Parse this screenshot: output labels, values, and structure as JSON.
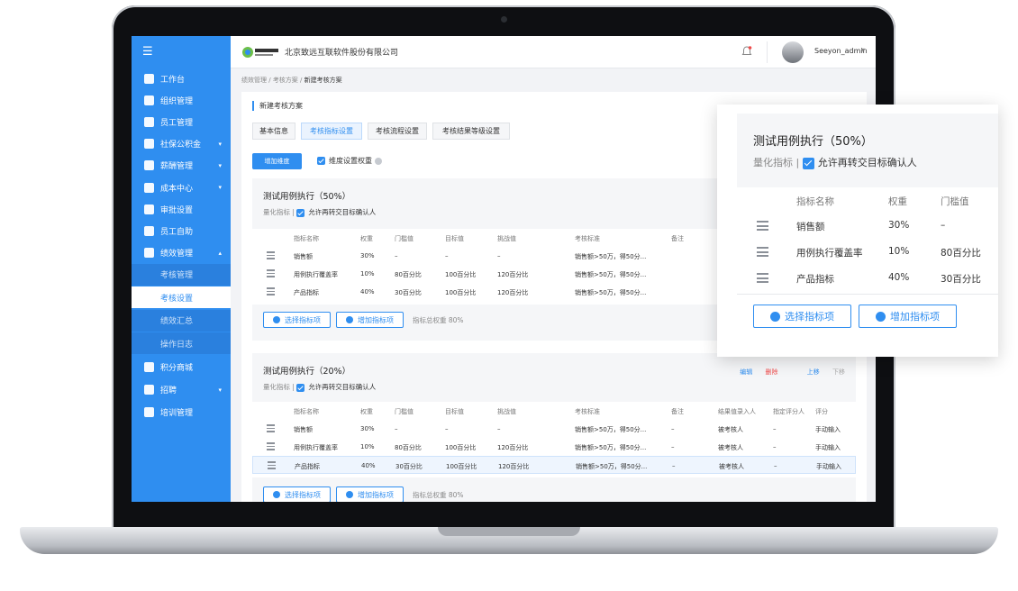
{
  "app": {
    "menu_toggle": "☰",
    "company": "北京致远互联软件股份有限公司",
    "logo_text": "致远互联",
    "username": "Seeyon_admin"
  },
  "sidebar": {
    "items": [
      {
        "label": "工作台",
        "icon": "desktop-icon"
      },
      {
        "label": "组织管理",
        "icon": "org-icon"
      },
      {
        "label": "员工管理",
        "icon": "user-icon"
      },
      {
        "label": "社保公积金",
        "icon": "shield-icon",
        "arrow": "▾"
      },
      {
        "label": "薪酬管理",
        "icon": "money-bag-icon",
        "arrow": "▾"
      },
      {
        "label": "成本中心",
        "icon": "grid-icon",
        "arrow": "▾"
      },
      {
        "label": "审批设置",
        "icon": "stamp-icon"
      },
      {
        "label": "员工自助",
        "icon": "person-icon"
      },
      {
        "label": "绩效管理",
        "icon": "chart-icon",
        "arrow": "▴"
      }
    ],
    "sub_items": [
      {
        "label": "考核管理"
      },
      {
        "label": "考核设置",
        "active": true
      },
      {
        "label": "绩效汇总"
      },
      {
        "label": "操作日志"
      }
    ],
    "items_after": [
      {
        "label": "积分商城",
        "icon": "gift-icon"
      },
      {
        "label": "招聘",
        "icon": "briefcase-icon",
        "arrow": "▾"
      },
      {
        "label": "培训管理",
        "icon": "graduation-icon"
      }
    ]
  },
  "breadcrumb": {
    "a": "绩效管理",
    "b": "考核方案",
    "c": "新建考核方案",
    "sep": " / "
  },
  "page": {
    "title": "新建考核方案",
    "tabs": [
      "基本信息",
      "考核指标设置",
      "考核流程设置",
      "考核结果等级设置"
    ],
    "add_dimension": "增加维度",
    "weight_toggle": "维度设置权重"
  },
  "columns": [
    "指标名称",
    "权重",
    "门槛值",
    "目标值",
    "挑战值",
    "考核标准",
    "备注",
    "结果值录入人",
    "指定评分人",
    "评分"
  ],
  "sections": [
    {
      "title": "测试用例执行（50%）",
      "quant": "量化指标",
      "pipe": "|",
      "allow": "允许再转交目标确认人",
      "rows": [
        [
          "销售额",
          "30%",
          "–",
          "–",
          "–",
          "销售额>50万，得50分..."
        ],
        [
          "用例执行覆盖率",
          "10%",
          "80百分比",
          "100百分比",
          "120百分比",
          "销售额>50万，得50分..."
        ],
        [
          "产品指标",
          "40%",
          "30百分比",
          "100百分比",
          "120百分比",
          "销售额>50万，得50分..."
        ]
      ],
      "select_btn": "选择指标项",
      "add_btn": "增加指标项",
      "total": "指标总权重 80%"
    },
    {
      "title": "测试用例执行（20%）",
      "quant": "量化指标",
      "pipe": "|",
      "allow": "允许再转交目标确认人",
      "actions": {
        "edit": "编辑",
        "delete": "删除",
        "up": "上移",
        "down": "下移"
      },
      "rows": [
        [
          "销售额",
          "30%",
          "–",
          "–",
          "–",
          "销售额>50万，得50分...",
          "–",
          "被考核人",
          "–",
          "手动输入"
        ],
        [
          "用例执行覆盖率",
          "10%",
          "80百分比",
          "100百分比",
          "120百分比",
          "销售额>50万，得50分...",
          "–",
          "被考核人",
          "–",
          "手动输入"
        ],
        [
          "产品指标",
          "40%",
          "30百分比",
          "100百分比",
          "120百分比",
          "销售额>50万，得50分...",
          "–",
          "被考核人",
          "–",
          "手动输入"
        ]
      ],
      "select_btn": "选择指标项",
      "add_btn": "增加指标项",
      "total": "指标总权重 80%"
    }
  ],
  "zoom": {
    "title": "测试用例执行（50%）",
    "quant": "量化指标",
    "pipe": "|",
    "allow": "允许再转交目标确认人",
    "columns": [
      "指标名称",
      "权重",
      "门槛值"
    ],
    "rows": [
      [
        "销售额",
        "30%",
        "–"
      ],
      [
        "用例执行覆盖率",
        "10%",
        "80百分比"
      ],
      [
        "产品指标",
        "40%",
        "30百分比"
      ]
    ],
    "select_btn": "选择指标项",
    "add_btn": "增加指标项"
  },
  "colors": {
    "accent": "#2f8ef0",
    "danger": "#f04b4b",
    "sidebar": "#2f8ef0"
  }
}
